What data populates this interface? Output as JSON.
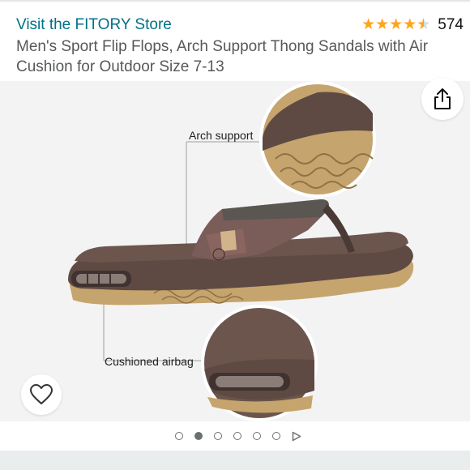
{
  "header": {
    "store_link": "Visit the FITORY Store",
    "rating_stars": 4.5,
    "review_count": "574",
    "product_title": "Men's Sport Flip Flops, Arch Support Thong Sandals with Air Cushion for Outdoor Size 7-13"
  },
  "gallery": {
    "callouts": {
      "arch": "Arch support",
      "cushion": "Cushioned airbag"
    }
  },
  "pager": {
    "count": 6,
    "active_index": 1
  },
  "colors": {
    "link": "#007185",
    "star": "#ffa41c",
    "sandal_brown": "#5e4a42",
    "sole_tan": "#c6a46d"
  },
  "icons": {
    "share": "share-icon",
    "favorite": "heart-icon",
    "video": "play-icon"
  }
}
